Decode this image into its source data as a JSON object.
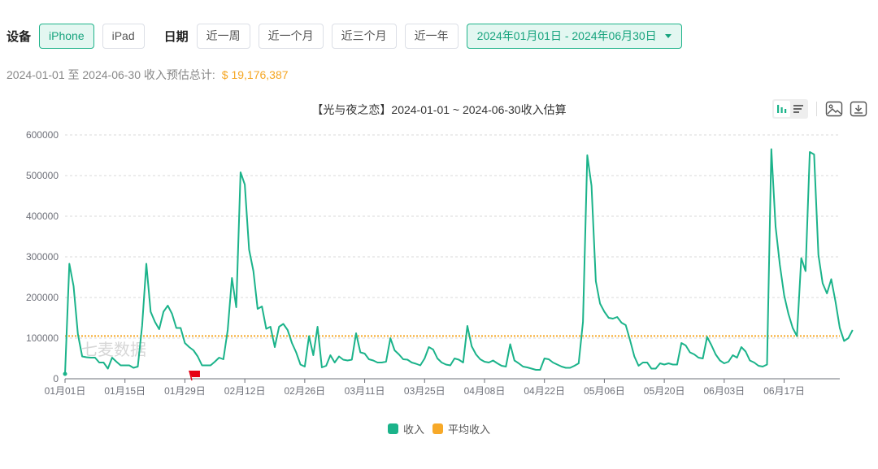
{
  "filters": {
    "device_label": "设备",
    "devices": [
      {
        "label": "iPhone",
        "active": true
      },
      {
        "label": "iPad",
        "active": false
      }
    ],
    "date_label": "日期",
    "ranges": [
      {
        "label": "近一周"
      },
      {
        "label": "近一个月"
      },
      {
        "label": "近三个月"
      },
      {
        "label": "近一年"
      }
    ],
    "date_picker": "2024年01月01日 - 2024年06月30日"
  },
  "summary": {
    "text": "2024-01-01 至 2024-06-30 收入预估总计:",
    "amount": "$ 19,176,387"
  },
  "toolbar": {
    "icons": [
      "bar-chart-icon",
      "list-icon",
      "image-icon",
      "download-icon"
    ]
  },
  "watermark": "七麦数据",
  "colors": {
    "income": "#1bb38a",
    "average": "#f7a928",
    "active_accent": "#16a37d",
    "amount": "#f5a623",
    "flag": "#e60012"
  },
  "chart_data": {
    "type": "line",
    "title": "【光与夜之恋】2024-01-01 ~ 2024-06-30收入估算",
    "xlabel": "",
    "ylabel": "",
    "ylim": [
      0,
      600000
    ],
    "yticks": [
      0,
      100000,
      200000,
      300000,
      400000,
      500000,
      600000
    ],
    "xtick_labels": [
      "01月01日",
      "01月15日",
      "01月29日",
      "02月12日",
      "02月26日",
      "03月11日",
      "03月25日",
      "04月08日",
      "04月22日",
      "05月06日",
      "05月20日",
      "06月03日",
      "06月17日"
    ],
    "xtick_day_index": [
      0,
      14,
      28,
      42,
      56,
      70,
      84,
      98,
      112,
      126,
      140,
      154,
      168
    ],
    "start_date": "2024-01-01",
    "end_date": "2024-06-30",
    "grid": true,
    "legend": "bottom-center",
    "flag_marker_day_index": 30,
    "series": [
      {
        "name": "收入",
        "values": [
          12000,
          283000,
          228000,
          110000,
          55000,
          53000,
          52000,
          52000,
          40000,
          40000,
          25000,
          52000,
          42000,
          33000,
          33000,
          33000,
          27000,
          30000,
          130000,
          283000,
          165000,
          140000,
          122000,
          165000,
          180000,
          160000,
          125000,
          125000,
          88000,
          78000,
          70000,
          55000,
          33000,
          33000,
          33000,
          42000,
          52000,
          48000,
          120000,
          248000,
          176000,
          508000,
          478000,
          318000,
          265000,
          172000,
          178000,
          123000,
          128000,
          78000,
          128000,
          135000,
          120000,
          88000,
          65000,
          35000,
          30000,
          105000,
          58000,
          128000,
          28000,
          32000,
          58000,
          40000,
          55000,
          47000,
          45000,
          47000,
          112000,
          65000,
          62000,
          48000,
          45000,
          40000,
          40000,
          42000,
          100000,
          70000,
          60000,
          48000,
          47000,
          40000,
          37000,
          33000,
          50000,
          78000,
          72000,
          50000,
          40000,
          35000,
          33000,
          50000,
          47000,
          40000,
          130000,
          80000,
          60000,
          48000,
          42000,
          40000,
          45000,
          38000,
          32000,
          30000,
          85000,
          45000,
          38000,
          30000,
          28000,
          25000,
          22000,
          22000,
          50000,
          48000,
          40000,
          35000,
          30000,
          27000,
          27000,
          32000,
          38000,
          140000,
          550000,
          475000,
          240000,
          185000,
          165000,
          150000,
          148000,
          152000,
          138000,
          132000,
          95000,
          55000,
          32000,
          40000,
          40000,
          25000,
          25000,
          38000,
          35000,
          38000,
          35000,
          35000,
          88000,
          82000,
          65000,
          60000,
          52000,
          50000,
          103000,
          83000,
          60000,
          45000,
          38000,
          42000,
          58000,
          52000,
          78000,
          67000,
          45000,
          40000,
          32000,
          30000,
          35000,
          565000,
          375000,
          280000,
          205000,
          160000,
          125000,
          105000,
          297000,
          265000,
          558000,
          552000,
          305000,
          235000,
          210000,
          245000,
          190000,
          125000,
          93000,
          100000,
          120000
        ]
      },
      {
        "name": "平均收入",
        "values_constant": 105364
      }
    ]
  }
}
